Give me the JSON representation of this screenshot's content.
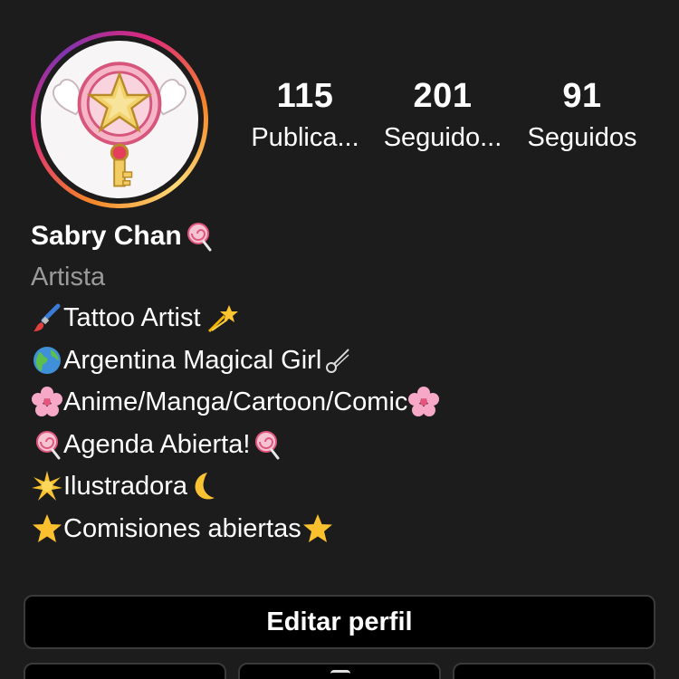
{
  "stats": {
    "posts": {
      "value": "115",
      "label": "Publica..."
    },
    "followers": {
      "value": "201",
      "label": "Seguido..."
    },
    "following": {
      "value": "91",
      "label": "Seguidos"
    }
  },
  "profile": {
    "name": "Sabry Chan",
    "name_emoji": "lollipop-icon",
    "category": "Artista"
  },
  "bio_lines": [
    {
      "text": "Tattoo Artist ",
      "lead_icon": "paintbrush-icon",
      "trail_icon": "shooting-star-icon"
    },
    {
      "text": "Argentina Magical Girl",
      "lead_icon": "globe-icon",
      "trail_icon": "comet-icon"
    },
    {
      "text": "Anime/Manga/Cartoon/Comic",
      "lead_icon": "cherry-blossom-icon",
      "trail_icon": "cherry-blossom-icon"
    },
    {
      "text": "Agenda Abierta!",
      "lead_icon": "lollipop-icon",
      "trail_icon": "lollipop-icon"
    },
    {
      "text": "Ilustradora",
      "lead_icon": "sun-sparkle-icon",
      "trail_icon": "crescent-moon-icon"
    },
    {
      "text": "Comisiones abiertas",
      "lead_icon": "star-icon",
      "trail_icon": "star-icon"
    }
  ],
  "actions": {
    "edit_profile_label": "Editar perfil"
  },
  "colors": {
    "background": "#1c1c1c",
    "button_bg": "#000000",
    "button_border": "#3a3a3a",
    "secondary_text": "#9a9a9a",
    "story_ring": [
      "#f58529",
      "#dd2a7b",
      "#8134af"
    ]
  }
}
